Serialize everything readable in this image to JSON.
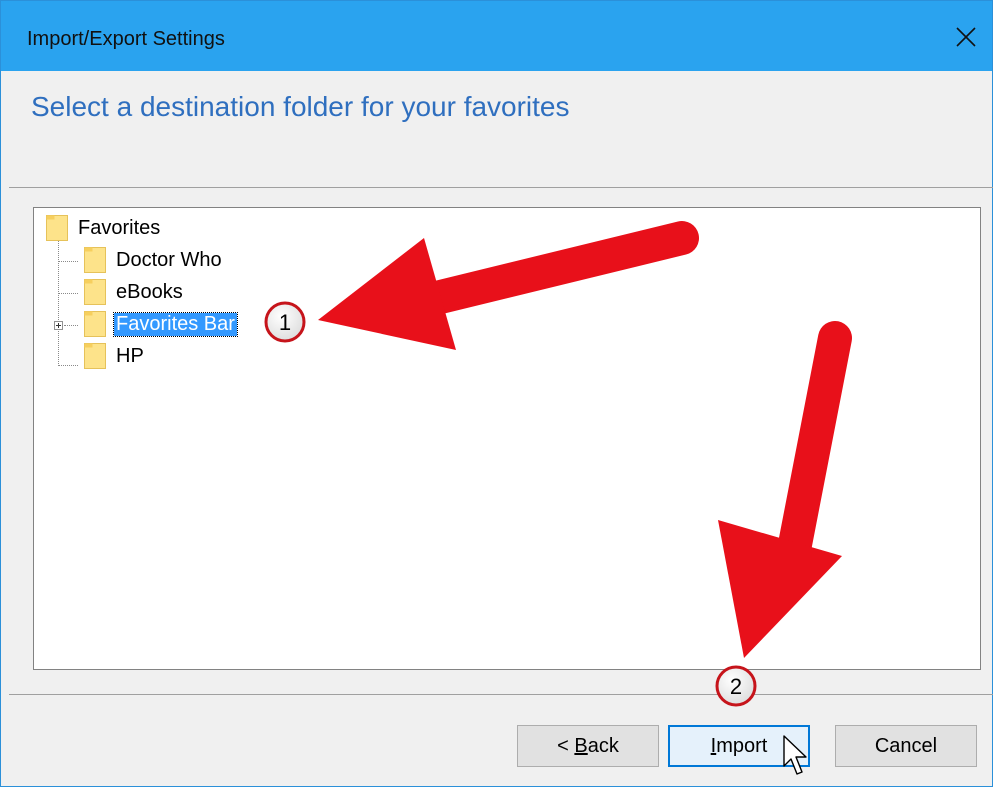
{
  "window": {
    "title": "Import/Export Settings",
    "close_glyph": "✕",
    "accent_color": "#2aa3ef"
  },
  "header": {
    "heading": "Select a destination folder for your favorites"
  },
  "tree": {
    "root": {
      "label": "Favorites",
      "icon": "folder-icon"
    },
    "children": [
      {
        "label": "Doctor Who",
        "icon": "folder-icon",
        "selected": false,
        "expandable": false
      },
      {
        "label": "eBooks",
        "icon": "folder-icon",
        "selected": false,
        "expandable": false
      },
      {
        "label": "Favorites Bar",
        "icon": "folder-icon",
        "selected": true,
        "expandable": true
      },
      {
        "label": "HP",
        "icon": "folder-icon",
        "selected": false,
        "expandable": false
      }
    ]
  },
  "buttons": {
    "back": {
      "prefix": "< ",
      "mnemonic": "B",
      "rest": "ack"
    },
    "import": {
      "mnemonic": "I",
      "rest": "mport"
    },
    "cancel": {
      "label": "Cancel"
    }
  },
  "annotations": {
    "step1": "1",
    "step2": "2",
    "arrow_color": "#e8101a"
  }
}
